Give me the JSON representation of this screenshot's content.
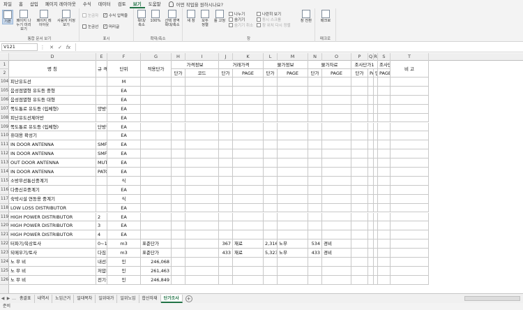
{
  "menu": {
    "tabs": [
      "파일",
      "홈",
      "삽입",
      "페이지 레이아웃",
      "수식",
      "데이터",
      "검토",
      "보기",
      "도움말"
    ],
    "active": "보기",
    "tell_me": "어떤 작업을 원하시나요?"
  },
  "ribbon": {
    "views": {
      "normal": "기본",
      "page_break": "페이지 나누기 미리 보기",
      "page_layout": "페이지 레이아웃",
      "custom": "사용자 지정 보기",
      "label": "통합 문서 보기"
    },
    "show": {
      "ruler": "눈금자",
      "formula_bar": "수식 입력줄",
      "gridlines": "눈금선",
      "headings": "머리글",
      "label": "표시"
    },
    "zoom": {
      "zoom": "확대/축소",
      "hundred": "100%",
      "to_selection": "선택 영역 확대/축소",
      "label": "확대/축소"
    },
    "window": {
      "new": "새 창",
      "arrange": "모두 정렬",
      "freeze": "틀 고정",
      "split": "나누기",
      "hide": "숨기기",
      "unhide": "숨기기 취소",
      "side_by_side": "나란히 보기",
      "sync_scroll": "동시 스크롤",
      "reset_pos": "창 위치 다시 정렬",
      "switch": "창 전환",
      "label": "창"
    },
    "macros": {
      "macros": "매크로",
      "label": "매크로"
    }
  },
  "formula_bar": {
    "name_box": "V121",
    "cancel": "✕",
    "enter": "✓",
    "fx": "fx",
    "value": ""
  },
  "columns": [
    "C",
    "D",
    "E",
    "F",
    "G",
    "H",
    "I",
    "J",
    "K",
    "L",
    "M",
    "N",
    "O",
    "P",
    "Q",
    "R",
    "S",
    "T"
  ],
  "header": {
    "name": "명        칭",
    "spec": "규        격",
    "unit": "단위",
    "base_price": "적용단가",
    "price_info": "가격정보",
    "trade_price": "거래가격",
    "price_info2": "물가정보",
    "price_data": "물가자료",
    "survey1": "조사단가1",
    "survey2": "조사단가2",
    "note": "비  고",
    "unit_price": "단가",
    "code": "코드",
    "page": "PAGE",
    "survey_short": "단가"
  },
  "rows": [
    {
      "no": "104",
      "name": "피난유도선",
      "spec": "",
      "unit": "M",
      "g": "",
      "h": "",
      "j": "",
      "k": "",
      "l": "",
      "m": "",
      "n": "",
      "o": ""
    },
    {
      "no": "105",
      "name": "음성점멸형 유도등 중형",
      "spec": "",
      "unit": "EA",
      "g": "",
      "h": "",
      "j": "",
      "k": "",
      "l": "",
      "m": "",
      "n": "",
      "o": ""
    },
    {
      "no": "106",
      "name": "음성점멸형 유도등 대형",
      "spec": "",
      "unit": "EA",
      "g": "",
      "h": "",
      "j": "",
      "k": "",
      "l": "",
      "m": "",
      "n": "",
      "o": ""
    },
    {
      "no": "107",
      "name": "쪽도통로 유도등 (입체형)",
      "spec": "양방향",
      "unit": "EA",
      "g": "",
      "h": "",
      "j": "",
      "k": "",
      "l": "",
      "m": "",
      "n": "",
      "o": ""
    },
    {
      "no": "108",
      "name": "피난유도선제어반",
      "spec": "",
      "unit": "EA",
      "g": "",
      "h": "",
      "j": "",
      "k": "",
      "l": "",
      "m": "",
      "n": "",
      "o": ""
    },
    {
      "no": "109",
      "name": "쪽도통로 유도등 (입체형)",
      "spec": "단방향",
      "unit": "EA",
      "g": "",
      "h": "",
      "j": "",
      "k": "",
      "l": "",
      "m": "",
      "n": "",
      "o": ""
    },
    {
      "no": "110",
      "name": "휴대용 확성기",
      "spec": "",
      "unit": "EA",
      "g": "",
      "h": "",
      "j": "",
      "k": "",
      "l": "",
      "m": "",
      "n": "",
      "o": ""
    },
    {
      "no": "111",
      "name": "IN DOOR ANTENNA",
      "spec": "SMF-400Z",
      "unit": "EA",
      "g": "",
      "h": "",
      "j": "",
      "k": "",
      "l": "",
      "m": "",
      "n": "",
      "o": ""
    },
    {
      "no": "112",
      "name": "IN DOOR ANTENNA",
      "spec": "SMF-500Z",
      "unit": "EA",
      "g": "",
      "h": "",
      "j": "",
      "k": "",
      "l": "",
      "m": "",
      "n": "",
      "o": ""
    },
    {
      "no": "113",
      "name": "OUT DOOR ANTENNA",
      "spec": "MUTI-FACE",
      "unit": "EA",
      "g": "",
      "h": "",
      "j": "",
      "k": "",
      "l": "",
      "m": "",
      "n": "",
      "o": ""
    },
    {
      "no": "114",
      "name": "IN DOOR ANTENNA",
      "spec": "PATCH ANTENNA",
      "unit": "EA",
      "g": "",
      "h": "",
      "j": "",
      "k": "",
      "l": "",
      "m": "",
      "n": "",
      "o": ""
    },
    {
      "no": "115",
      "name": "소방무선통신중계기",
      "spec": "",
      "unit": "식",
      "g": "",
      "h": "",
      "j": "",
      "k": "",
      "l": "",
      "m": "",
      "n": "",
      "o": ""
    },
    {
      "no": "116",
      "name": "다중신호중계기",
      "spec": "",
      "unit": "EA",
      "g": "",
      "h": "",
      "j": "",
      "k": "",
      "l": "",
      "m": "",
      "n": "",
      "o": ""
    },
    {
      "no": "117",
      "name": "숙박시설 연동용 중계기",
      "spec": "",
      "unit": "식",
      "g": "",
      "h": "",
      "j": "",
      "k": "",
      "l": "",
      "m": "",
      "n": "",
      "o": ""
    },
    {
      "no": "118",
      "name": "LOW LOSS DISTRIBUTOR",
      "spec": "",
      "unit": "EA",
      "g": "",
      "h": "",
      "j": "",
      "k": "",
      "l": "",
      "m": "",
      "n": "",
      "o": ""
    },
    {
      "no": "119",
      "name": "HIGH POWER DISTRIBUTOR",
      "spec": "2",
      "unit": "EA",
      "g": "",
      "h": "",
      "j": "",
      "k": "",
      "l": "",
      "m": "",
      "n": "",
      "o": ""
    },
    {
      "no": "120",
      "name": "HIGH POWER DISTRIBUTOR",
      "spec": "3",
      "unit": "EA",
      "g": "",
      "h": "",
      "j": "",
      "k": "",
      "l": "",
      "m": "",
      "n": "",
      "o": ""
    },
    {
      "no": "121",
      "name": "HIGH POWER DISTRIBUTOR",
      "spec": "4",
      "unit": "EA",
      "g": "",
      "h": "",
      "j": "",
      "k": "",
      "l": "",
      "m": "",
      "n": "",
      "o": ""
    },
    {
      "no": "122",
      "name": "터파기/육상토사",
      "spec": "0~1m(인력 10%)",
      "unit": "m3",
      "g": "표준단가",
      "h": "",
      "j": "367",
      "k": "재료",
      "l": "2,316",
      "m": "노무",
      "n": "534",
      "o": "경비"
    },
    {
      "no": "123",
      "name": "되메우기/토사",
      "spec": "다짐",
      "unit": "m3",
      "g": "표준단가",
      "h": "",
      "j": "433",
      "k": "재료",
      "l": "5,323",
      "m": "노무",
      "n": "433",
      "o": "경비"
    },
    {
      "no": "124",
      "name": "노 무 비",
      "spec": "내선전공",
      "unit": "인",
      "g": "246,068",
      "h": "",
      "j": "",
      "k": "",
      "l": "",
      "m": "",
      "n": "",
      "o": ""
    },
    {
      "no": "125",
      "name": "노 무 비",
      "spec": "저압케이블전공",
      "unit": "인",
      "g": "261,463",
      "h": "",
      "j": "",
      "k": "",
      "l": "",
      "m": "",
      "n": "",
      "o": ""
    },
    {
      "no": "126",
      "name": "노 무 비",
      "spec": "전기공사산업기사",
      "unit": "인",
      "g": "246,849",
      "h": "",
      "j": "",
      "k": "",
      "l": "",
      "m": "",
      "n": "",
      "o": ""
    }
  ],
  "sheet_tabs": [
    "총괄표",
    "내역서",
    "노임근거",
    "일대목차",
    "일위대가",
    "일위노임",
    "합산자재",
    "단가조사"
  ],
  "active_sheet": "단가조사",
  "status": "준비"
}
